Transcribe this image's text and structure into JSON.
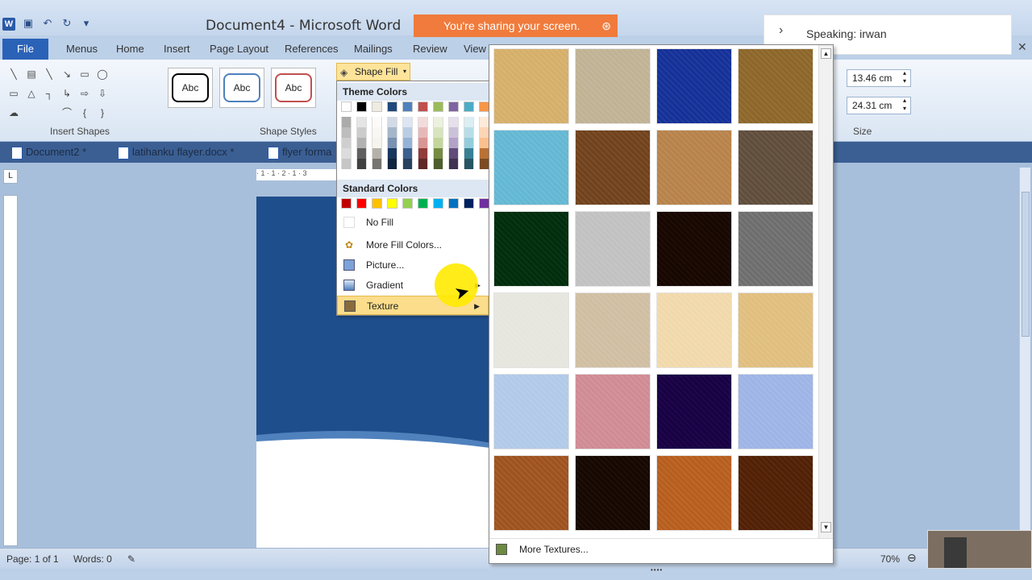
{
  "window": {
    "title": "Document4 - Microsoft Word",
    "share_banner": "You're sharing your screen.",
    "speaking": "Speaking: irwan"
  },
  "tabs": [
    "File",
    "Menus",
    "Home",
    "Insert",
    "Page Layout",
    "References",
    "Mailings",
    "Review",
    "View"
  ],
  "ribbon": {
    "insert_shapes_label": "Insert Shapes",
    "shape_styles_label": "Shape Styles",
    "style_sample": "Abc",
    "shape_fill_label": "Shape Fill",
    "size_label": "Size",
    "height": "13.46 cm",
    "width": "24.31 cm"
  },
  "doc_tabs": [
    "Document2 *",
    "latihanku flayer.docx *",
    "flyer forma"
  ],
  "dropdown": {
    "theme_colors_label": "Theme Colors",
    "standard_colors_label": "Standard Colors",
    "theme_top": [
      "#ffffff",
      "#000000",
      "#eeece1",
      "#1f497d",
      "#4f81bd",
      "#c0504d",
      "#9bbb59",
      "#8064a2",
      "#4bacc6",
      "#f79646"
    ],
    "standard": [
      "#c00000",
      "#ff0000",
      "#ffc000",
      "#ffff00",
      "#92d050",
      "#00b050",
      "#00b0f0",
      "#0070c0",
      "#002060",
      "#7030a0"
    ],
    "items": {
      "no_fill": "No Fill",
      "more_colors": "More Fill Colors...",
      "picture": "Picture...",
      "gradient": "Gradient",
      "texture": "Texture"
    }
  },
  "gallery": {
    "more_textures": "More Textures...",
    "textures": [
      [
        "#e9d3a4",
        "#ddd5c2",
        "#4a6fc4",
        "#bda167"
      ],
      [
        "#9fd8e8",
        "#a98257",
        "#d8b68a",
        "#9c8c7c"
      ],
      [
        "#1d6a3a",
        "#dedede",
        "#4b2b18",
        "#a7a7a7"
      ],
      [
        "#f2f2ee",
        "#e6dccb",
        "#f8ebd1",
        "#efdcb3"
      ],
      [
        "#d4e3f3",
        "#e6bcc2",
        "#4d1782",
        "#c8d6f2"
      ],
      [
        "#c9915a",
        "#4a2d1a",
        "#d89a5b",
        "#8f5a2a"
      ]
    ]
  },
  "statusbar": {
    "page": "Page: 1 of 1",
    "words": "Words: 0",
    "zoom": "70%"
  }
}
